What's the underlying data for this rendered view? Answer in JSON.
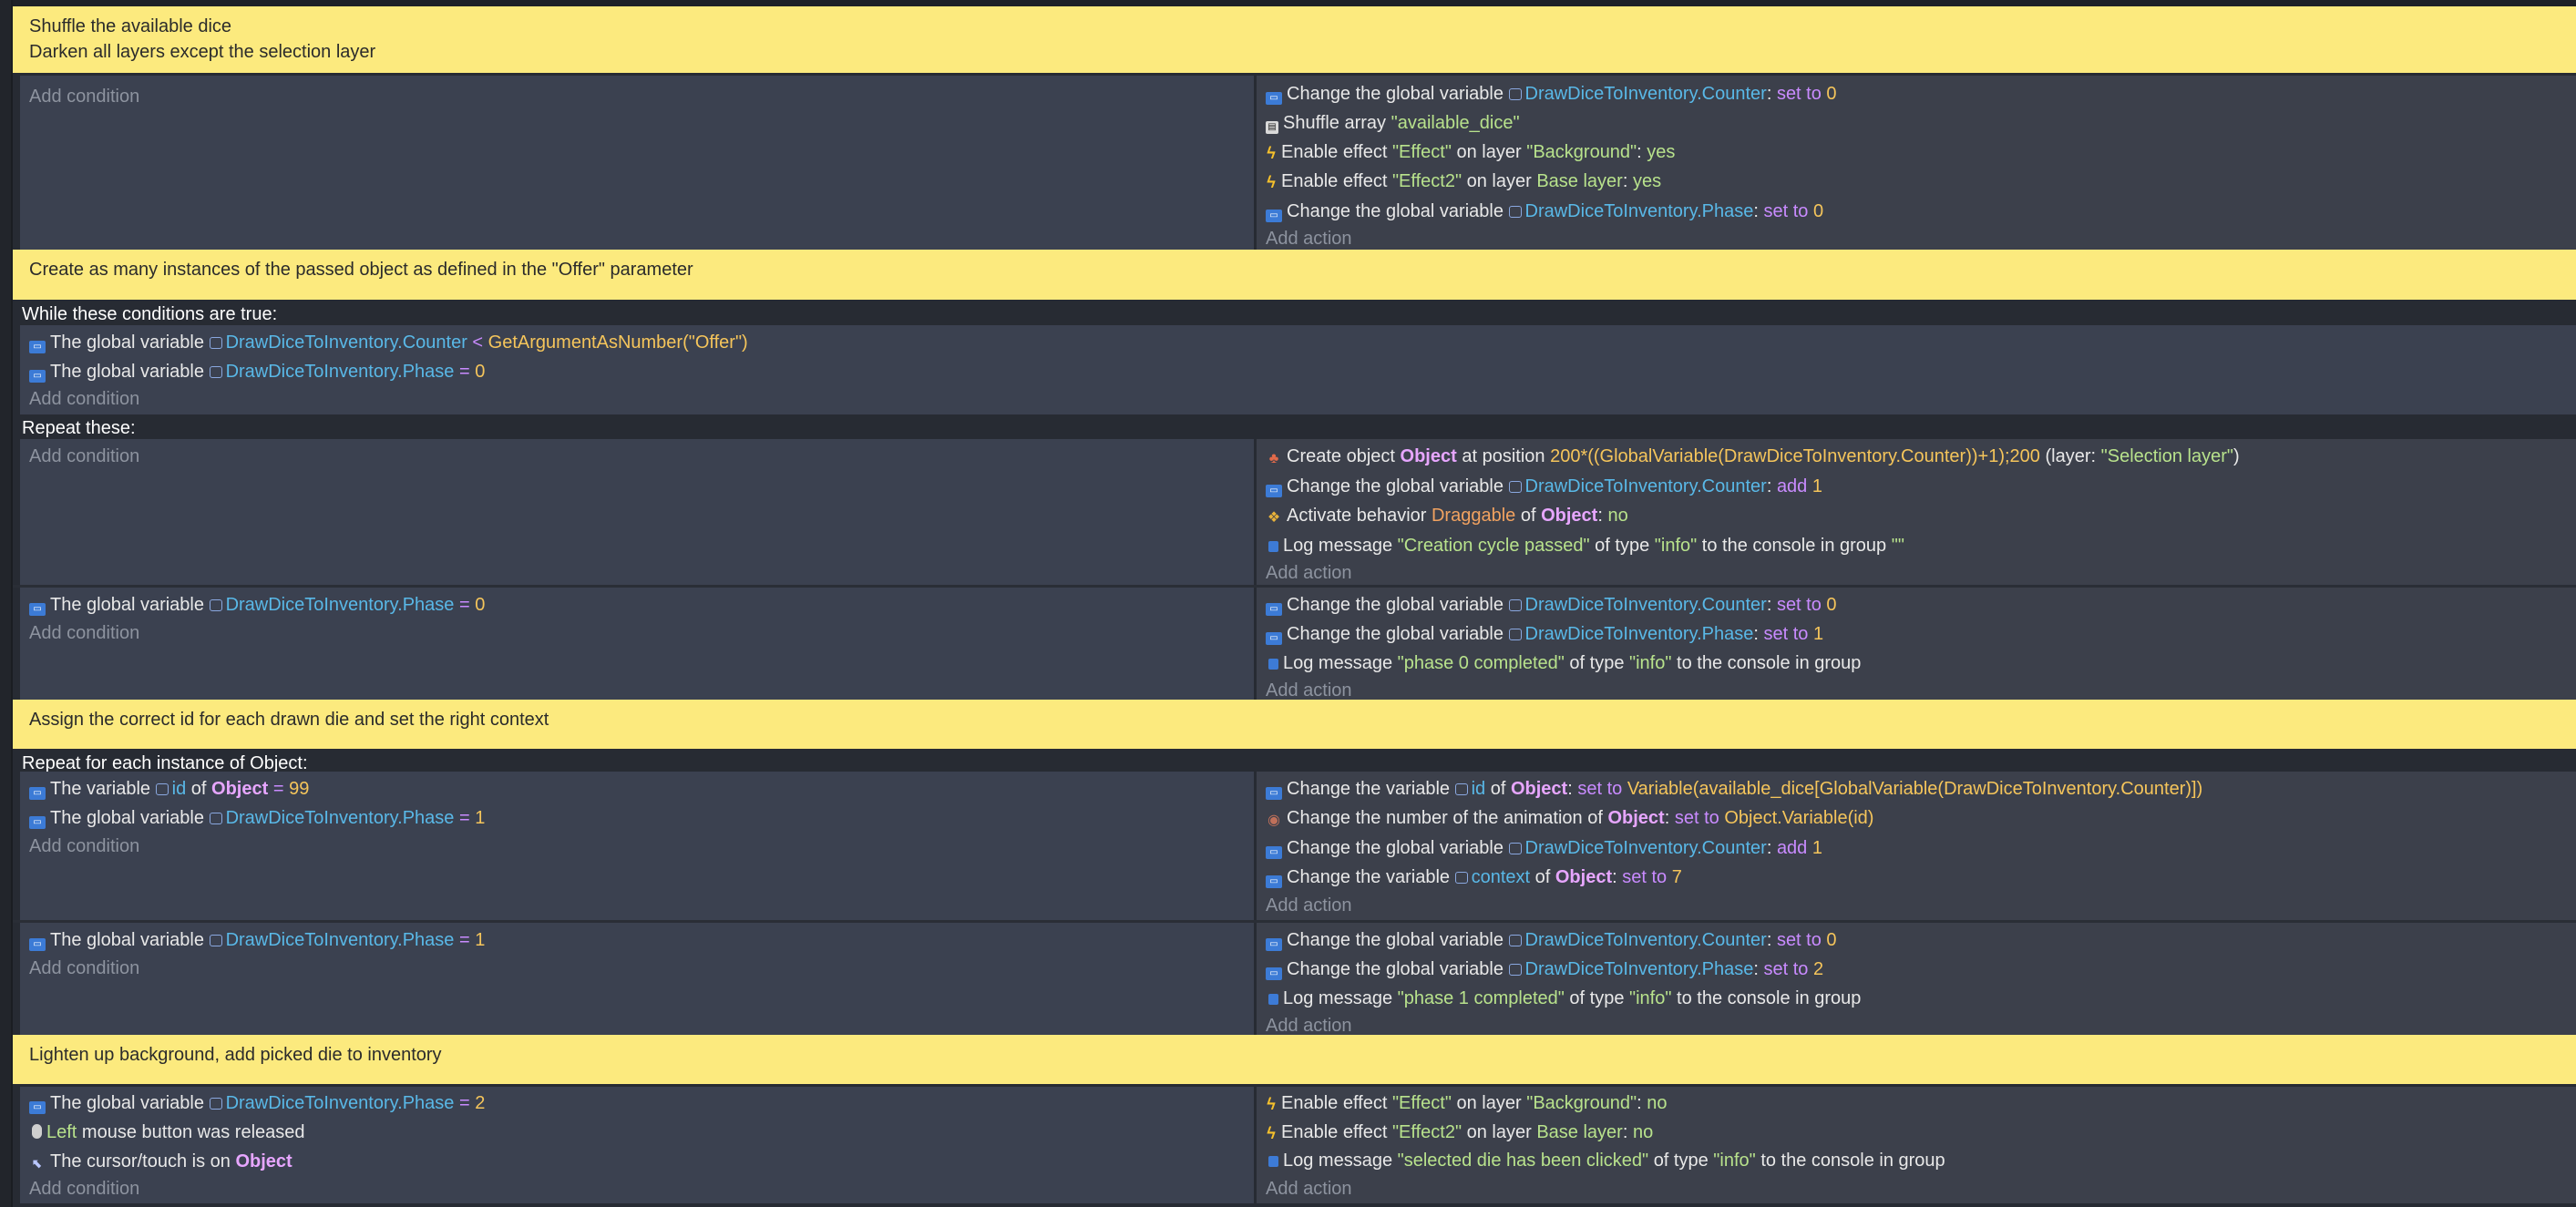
{
  "events": {
    "s1": {
      "comment": [
        "Shuffle the available dice",
        "Darken all layers except the selection layer"
      ],
      "add_condition": "Add condition",
      "add_action": "Add action",
      "actions": {
        "a1": {
          "pre": "Change the global variable",
          "var": "DrawDiceToInventory.Counter",
          "colon": ":",
          "op": "set to",
          "val": "0"
        },
        "a2": {
          "pre": "Shuffle array",
          "str": "\"available_dice\""
        },
        "a3": {
          "pre": "Enable effect",
          "s1": "\"Effect\"",
          "mid": "on layer",
          "s2": "\"Background\"",
          "colon": ":",
          "val": "yes"
        },
        "a4": {
          "pre": "Enable effect",
          "s1": "\"Effect2\"",
          "mid": "on layer",
          "s2": "Base layer",
          "colon": ":",
          "val": "yes"
        },
        "a5": {
          "pre": "Change the global variable",
          "var": "DrawDiceToInventory.Phase",
          "colon": ":",
          "op": "set to",
          "val": "0"
        }
      }
    },
    "s2": {
      "comment": "Create as many instances of the passed object as defined in the \"Offer\" parameter",
      "while_label": "While these conditions are true:",
      "repeat_label": "Repeat these:",
      "add_condition": "Add condition",
      "add_action": "Add action",
      "while_conditions": {
        "c1": {
          "pre": "The global variable",
          "var": "DrawDiceToInventory.Counter",
          "op": "<",
          "val": "GetArgumentAsNumber(\"Offer\")"
        },
        "c2": {
          "pre": "The global variable",
          "var": "DrawDiceToInventory.Phase",
          "op": "=",
          "val": "0"
        }
      },
      "repeat_actions": {
        "a1": {
          "pre": "Create object",
          "obj": "Object",
          "mid": "at position",
          "val": "200*((GlobalVariable(DrawDiceToInventory.Counter))+1);200",
          "post": "(layer:",
          "str": "\"Selection layer\"",
          "close": ")"
        },
        "a2": {
          "pre": "Change the global variable",
          "var": "DrawDiceToInventory.Counter",
          "colon": ":",
          "op": "add",
          "val": "1"
        },
        "a3": {
          "pre": "Activate behavior",
          "beh": "Draggable",
          "mid": "of",
          "obj": "Object",
          "colon": ":",
          "val": "no"
        },
        "a4": {
          "pre": "Log message",
          "s1": "\"Creation cycle passed\"",
          "mid": "of type",
          "s2": "\"info\"",
          "post": "to the console in group",
          "s3": "\"\""
        }
      },
      "sub": {
        "c1": {
          "pre": "The global variable",
          "var": "DrawDiceToInventory.Phase",
          "op": "=",
          "val": "0"
        },
        "a1": {
          "pre": "Change the global variable",
          "var": "DrawDiceToInventory.Counter",
          "colon": ":",
          "op": "set to",
          "val": "0"
        },
        "a2": {
          "pre": "Change the global variable",
          "var": "DrawDiceToInventory.Phase",
          "colon": ":",
          "op": "set to",
          "val": "1"
        },
        "a3": {
          "pre": "Log message",
          "s1": "\"phase 0 completed\"",
          "mid": "of type",
          "s2": "\"info\"",
          "post": "to the console in group"
        }
      }
    },
    "s3": {
      "comment": "Assign the correct id for each drawn die and set the right context",
      "foreach_label": "Repeat for each instance of Object:",
      "add_condition": "Add condition",
      "add_action": "Add action",
      "conditions": {
        "c1": {
          "pre": "The variable",
          "var": "id",
          "mid": "of",
          "obj": "Object",
          "op": "=",
          "val": "99"
        },
        "c2": {
          "pre": "The global variable",
          "var": "DrawDiceToInventory.Phase",
          "op": "=",
          "val": "1"
        }
      },
      "actions": {
        "a1": {
          "pre": "Change the variable",
          "var": "id",
          "mid": "of",
          "obj": "Object",
          "colon": ":",
          "op": "set to",
          "val": "Variable(available_dice[GlobalVariable(DrawDiceToInventory.Counter)])"
        },
        "a2": {
          "pre": "Change the number of the animation of",
          "obj": "Object",
          "colon": ":",
          "op": "set to",
          "val": "Object.Variable(id)"
        },
        "a3": {
          "pre": "Change the global variable",
          "var": "DrawDiceToInventory.Counter",
          "colon": ":",
          "op": "add",
          "val": "1"
        },
        "a4": {
          "pre": "Change the variable",
          "var": "context",
          "mid": "of",
          "obj": "Object",
          "colon": ":",
          "op": "set to",
          "val": "7"
        }
      },
      "sub": {
        "c1": {
          "pre": "The global variable",
          "var": "DrawDiceToInventory.Phase",
          "op": "=",
          "val": "1"
        },
        "a1": {
          "pre": "Change the global variable",
          "var": "DrawDiceToInventory.Counter",
          "colon": ":",
          "op": "set to",
          "val": "0"
        },
        "a2": {
          "pre": "Change the global variable",
          "var": "DrawDiceToInventory.Phase",
          "colon": ":",
          "op": "set to",
          "val": "2"
        },
        "a3": {
          "pre": "Log message",
          "s1": "\"phase 1 completed\"",
          "mid": "of type",
          "s2": "\"info\"",
          "post": "to the console in group"
        }
      }
    },
    "s4": {
      "comment": "Lighten up background, add picked die to inventory",
      "add_condition": "Add condition",
      "add_action": "Add action",
      "conditions": {
        "c1": {
          "pre": "The global variable",
          "var": "DrawDiceToInventory.Phase",
          "op": "=",
          "val": "2"
        },
        "c2": {
          "btn": "Left",
          "post": "mouse button was released"
        },
        "c3": {
          "pre": "The cursor/touch is on",
          "obj": "Object"
        }
      },
      "actions": {
        "a1": {
          "pre": "Enable effect",
          "s1": "\"Effect\"",
          "mid": "on layer",
          "s2": "\"Background\"",
          "colon": ":",
          "val": "no"
        },
        "a2": {
          "pre": "Enable effect",
          "s1": "\"Effect2\"",
          "mid": "on layer",
          "s2": "Base layer",
          "colon": ":",
          "val": "no"
        },
        "a3": {
          "pre": "Log message",
          "s1": "\"selected die has been clicked\"",
          "mid": "of type",
          "s2": "\"info\"",
          "post": "to the console in group"
        }
      }
    }
  },
  "icons": {
    "variable": "variable-icon",
    "array": "shuffle-array-icon",
    "effect": "effect-lightning-icon",
    "create": "create-object-icon",
    "behavior": "behavior-icon",
    "log": "log-message-icon",
    "animation": "animation-icon",
    "mouse": "mouse-icon",
    "cursor": "cursor-on-object-icon"
  },
  "colors": {
    "comment_bg": "#fcea7e",
    "condition_bg": "#3b4150",
    "action_bg": "#3c404b",
    "variable": "#59b8e7",
    "string": "#b8e28c",
    "operator": "#c98bff",
    "number": "#f5c55b",
    "object": "#e7a6ff"
  }
}
